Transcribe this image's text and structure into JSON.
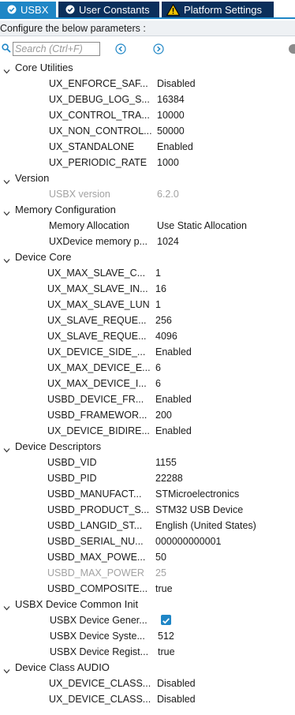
{
  "tabs": [
    {
      "label": "USBX",
      "icon": "gear-check-icon",
      "active": true
    },
    {
      "label": "User Constants",
      "icon": "gear-check-icon",
      "active": false
    },
    {
      "label": "Platform Settings",
      "icon": "warning-icon",
      "active": false
    }
  ],
  "configure_label": "Configure the below parameters :",
  "search": {
    "placeholder": "Search (Ctrl+F)"
  },
  "colors": {
    "tab_active": "#1f86c6",
    "tab_inactive": "#0b2f5b",
    "disabled_text": "#a2a2a2",
    "checkbox": "#1f86c6"
  },
  "groups": {
    "core_utilities": {
      "label": "Core Utilities",
      "params": [
        {
          "name": "UX_ENFORCE_SAF...",
          "value": "Disabled"
        },
        {
          "name": "UX_DEBUG_LOG_S...",
          "value": "16384"
        },
        {
          "name": "UX_CONTROL_TRA...",
          "value": "10000"
        },
        {
          "name": "UX_NON_CONTROL...",
          "value": "50000"
        },
        {
          "name": "UX_STANDALONE",
          "value": "Enabled"
        },
        {
          "name": "UX_PERIODIC_RATE",
          "value": "1000"
        }
      ]
    },
    "version": {
      "label": "Version",
      "params": [
        {
          "name": "USBX version",
          "value": "6.2.0",
          "disabled": true
        }
      ]
    },
    "memory_configuration": {
      "label": "Memory Configuration",
      "params": [
        {
          "name": "Memory Allocation",
          "value": "Use Static Allocation"
        },
        {
          "name": "UXDevice memory p...",
          "value": "1024"
        }
      ]
    },
    "device_core": {
      "label": "Device Core",
      "params": [
        {
          "name": "UX_MAX_SLAVE_C...",
          "value": "1"
        },
        {
          "name": "UX_MAX_SLAVE_IN...",
          "value": "16"
        },
        {
          "name": "UX_MAX_SLAVE_LUN",
          "value": "1"
        },
        {
          "name": "UX_SLAVE_REQUE...",
          "value": "256"
        },
        {
          "name": "UX_SLAVE_REQUE...",
          "value": "4096"
        },
        {
          "name": "UX_DEVICE_SIDE_...",
          "value": "Enabled"
        },
        {
          "name": "UX_MAX_DEVICE_E...",
          "value": "6"
        },
        {
          "name": "UX_MAX_DEVICE_I...",
          "value": "6"
        },
        {
          "name": "USBD_DEVICE_FR...",
          "value": "Enabled"
        },
        {
          "name": "USBD_FRAMEWOR...",
          "value": "200"
        },
        {
          "name": "UX_DEVICE_BIDIRE...",
          "value": "Enabled"
        }
      ]
    },
    "device_descriptors": {
      "label": "Device Descriptors",
      "params": [
        {
          "name": "USBD_VID",
          "value": "1155"
        },
        {
          "name": "USBD_PID",
          "value": "22288"
        },
        {
          "name": "USBD_MANUFACT...",
          "value": "STMicroelectronics"
        },
        {
          "name": "USBD_PRODUCT_S...",
          "value": "STM32 USB Device"
        },
        {
          "name": "USBD_LANGID_ST...",
          "value": "English (United States)"
        },
        {
          "name": "USBD_SERIAL_NU...",
          "value": "000000000001"
        },
        {
          "name": "USBD_MAX_POWE...",
          "value": "50"
        },
        {
          "name": "USBD_MAX_POWER",
          "value": "25",
          "disabled": true
        },
        {
          "name": "USBD_COMPOSITE...",
          "value": "true"
        }
      ]
    },
    "usbx_device_common_init": {
      "label": "USBX Device Common Init",
      "params": [
        {
          "name": "USBX Device Gener...",
          "value": "",
          "checkbox": true,
          "checked": true
        },
        {
          "name": "USBX Device Syste...",
          "value": "512"
        },
        {
          "name": "USBX Device Regist...",
          "value": "true"
        }
      ]
    },
    "device_class_audio": {
      "label": "Device Class AUDIO",
      "params": [
        {
          "name": "UX_DEVICE_CLASS...",
          "value": "Disabled"
        },
        {
          "name": "UX_DEVICE_CLASS...",
          "value": "Disabled"
        }
      ]
    }
  }
}
